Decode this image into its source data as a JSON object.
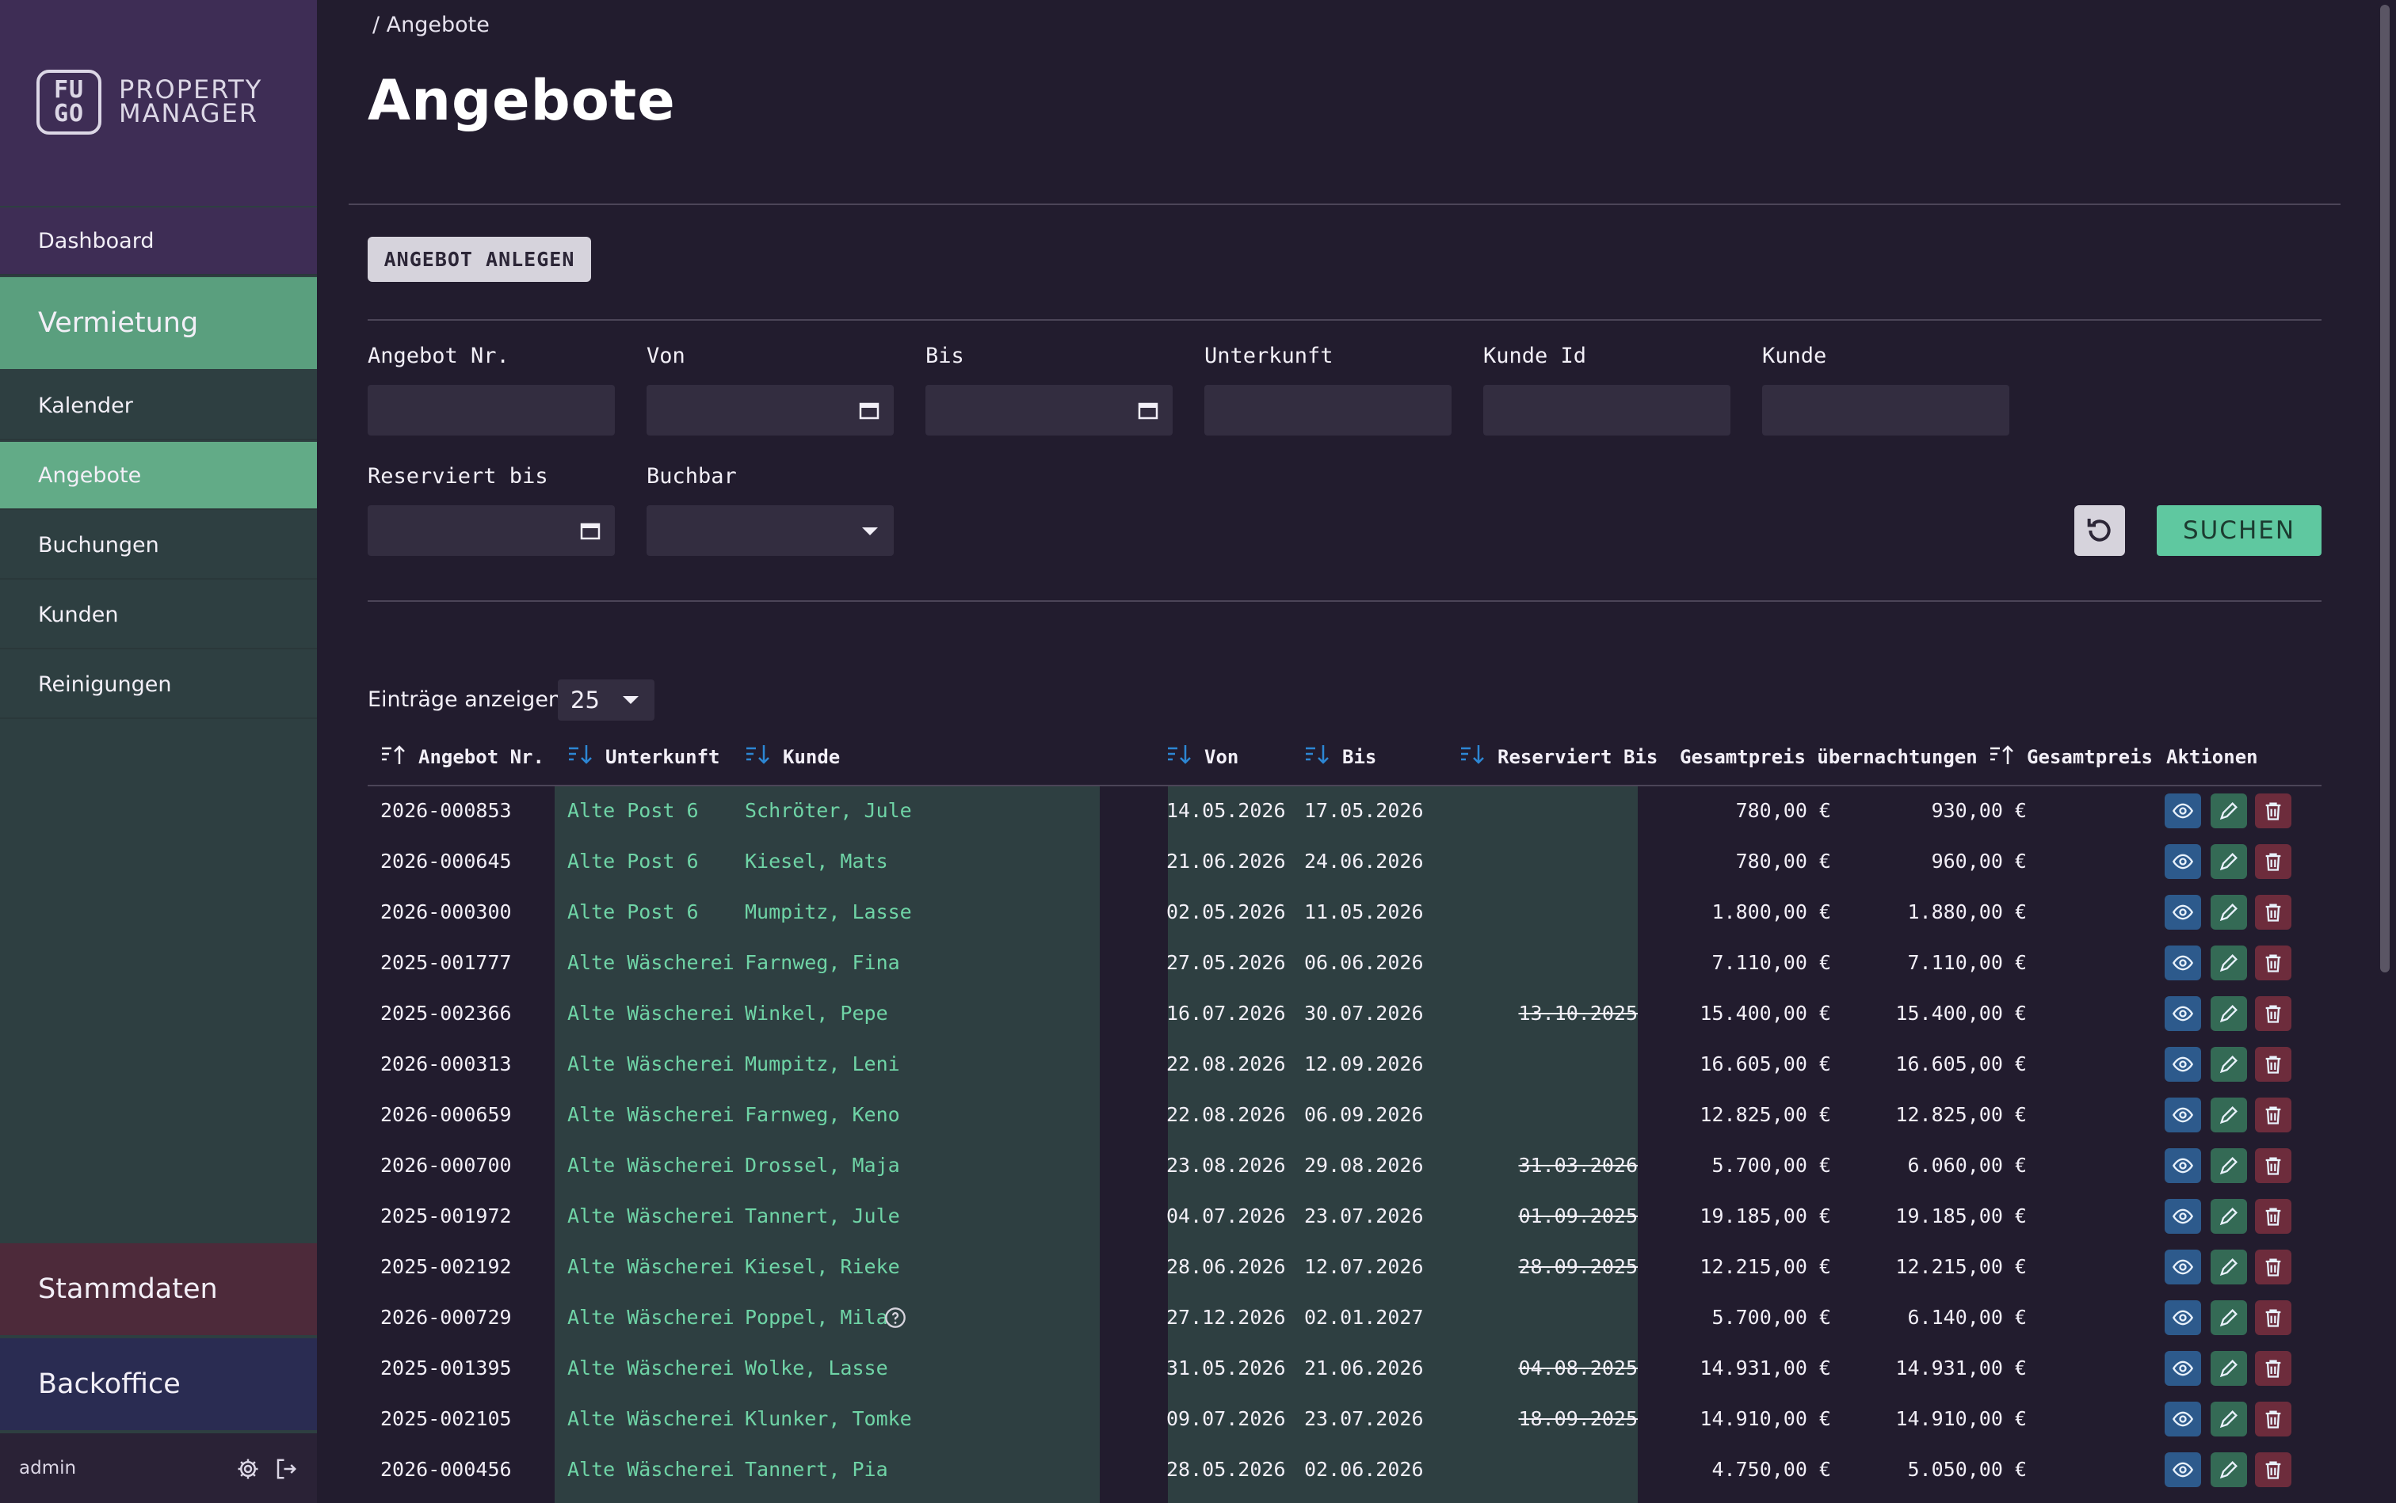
{
  "logo": {
    "mark_top": "FU",
    "mark_bottom": "GO",
    "line1": "PROPERTY",
    "line2": "MANAGER"
  },
  "sidebar": {
    "dashboard": "Dashboard",
    "vermietung": "Vermietung",
    "items": [
      {
        "label": "Kalender"
      },
      {
        "label": "Angebote",
        "active": true
      },
      {
        "label": "Buchungen"
      },
      {
        "label": "Kunden"
      },
      {
        "label": "Reinigungen"
      }
    ],
    "stammdaten": "Stammdaten",
    "backoffice": "Backoffice",
    "user": "admin",
    "settings_icon": "gear-icon",
    "logout_icon": "logout-icon"
  },
  "breadcrumb": "/ Angebote",
  "page_title": "Angebote",
  "create_button": "ANGEBOT ANLEGEN",
  "filters": {
    "angebot_nr": "Angebot Nr.",
    "von": "Von",
    "bis": "Bis",
    "unterkunft": "Unterkunft",
    "kunde_id": "Kunde Id",
    "kunde": "Kunde",
    "reserviert_bis": "Reserviert bis",
    "buchbar": "Buchbar",
    "search_button": "SUCHEN",
    "reset_icon": "reset-icon"
  },
  "entries": {
    "label": "Einträge anzeigen",
    "value": "25"
  },
  "table": {
    "headers": {
      "nr": "Angebot Nr.",
      "unterkunft": "Unterkunft",
      "kunde": "Kunde",
      "von": "Von",
      "bis": "Bis",
      "reserviert": "Reserviert Bis",
      "gp_uebernachtungen": "Gesamtpreis übernachtungen",
      "gesamtpreis": "Gesamtpreis",
      "aktionen": "Aktionen"
    },
    "rows": [
      {
        "nr": "2026-000853",
        "unterkunft": "Alte Post 6",
        "kunde": "Schröter, Jule",
        "von": "14.05.2026",
        "bis": "17.05.2026",
        "reserviert": "",
        "gp_uebernachtungen": "780,00 €",
        "gesamtpreis": "930,00 €"
      },
      {
        "nr": "2026-000645",
        "unterkunft": "Alte Post 6",
        "kunde": "Kiesel, Mats",
        "von": "21.06.2026",
        "bis": "24.06.2026",
        "reserviert": "",
        "gp_uebernachtungen": "780,00 €",
        "gesamtpreis": "960,00 €"
      },
      {
        "nr": "2026-000300",
        "unterkunft": "Alte Post 6",
        "kunde": "Mumpitz, Lasse",
        "von": "02.05.2026",
        "bis": "11.05.2026",
        "reserviert": "",
        "gp_uebernachtungen": "1.800,00 €",
        "gesamtpreis": "1.880,00 €"
      },
      {
        "nr": "2025-001777",
        "unterkunft": "Alte Wäscherei",
        "kunde": "Farnweg, Fina",
        "von": "27.05.2026",
        "bis": "06.06.2026",
        "reserviert": "",
        "gp_uebernachtungen": "7.110,00 €",
        "gesamtpreis": "7.110,00 €"
      },
      {
        "nr": "2025-002366",
        "unterkunft": "Alte Wäscherei",
        "kunde": "Winkel, Pepe",
        "von": "16.07.2026",
        "bis": "30.07.2026",
        "reserviert": "13.10.2025",
        "gp_uebernachtungen": "15.400,00 €",
        "gesamtpreis": "15.400,00 €"
      },
      {
        "nr": "2026-000313",
        "unterkunft": "Alte Wäscherei",
        "kunde": "Mumpitz, Leni",
        "von": "22.08.2026",
        "bis": "12.09.2026",
        "reserviert": "",
        "gp_uebernachtungen": "16.605,00 €",
        "gesamtpreis": "16.605,00 €"
      },
      {
        "nr": "2026-000659",
        "unterkunft": "Alte Wäscherei",
        "kunde": "Farnweg, Keno",
        "von": "22.08.2026",
        "bis": "06.09.2026",
        "reserviert": "",
        "gp_uebernachtungen": "12.825,00 €",
        "gesamtpreis": "12.825,00 €"
      },
      {
        "nr": "2026-000700",
        "unterkunft": "Alte Wäscherei",
        "kunde": "Drossel, Maja",
        "von": "23.08.2026",
        "bis": "29.08.2026",
        "reserviert": "31.03.2026",
        "gp_uebernachtungen": "5.700,00 €",
        "gesamtpreis": "6.060,00 €"
      },
      {
        "nr": "2025-001972",
        "unterkunft": "Alte Wäscherei",
        "kunde": "Tannert, Jule",
        "von": "04.07.2026",
        "bis": "23.07.2026",
        "reserviert": "01.09.2025",
        "gp_uebernachtungen": "19.185,00 €",
        "gesamtpreis": "19.185,00 €"
      },
      {
        "nr": "2025-002192",
        "unterkunft": "Alte Wäscherei",
        "kunde": "Kiesel, Rieke",
        "von": "28.06.2026",
        "bis": "12.07.2026",
        "reserviert": "28.09.2025",
        "gp_uebernachtungen": "12.215,00 €",
        "gesamtpreis": "12.215,00 €"
      },
      {
        "nr": "2026-000729",
        "unterkunft": "Alte Wäscherei",
        "kunde": "Poppel, Mila",
        "von": "27.12.2026",
        "bis": "02.01.2027",
        "reserviert": "",
        "gp_uebernachtungen": "5.700,00 €",
        "gesamtpreis": "6.140,00 €",
        "info": true
      },
      {
        "nr": "2025-001395",
        "unterkunft": "Alte Wäscherei",
        "kunde": "Wolke, Lasse",
        "von": "31.05.2026",
        "bis": "21.06.2026",
        "reserviert": "04.08.2025",
        "gp_uebernachtungen": "14.931,00 €",
        "gesamtpreis": "14.931,00 €"
      },
      {
        "nr": "2025-002105",
        "unterkunft": "Alte Wäscherei",
        "kunde": "Klunker, Tomke",
        "von": "09.07.2026",
        "bis": "23.07.2026",
        "reserviert": "18.09.2025",
        "gp_uebernachtungen": "14.910,00 €",
        "gesamtpreis": "14.910,00 €"
      },
      {
        "nr": "2026-000456",
        "unterkunft": "Alte Wäscherei",
        "kunde": "Tannert, Pia",
        "von": "28.05.2026",
        "bis": "02.06.2026",
        "reserviert": "",
        "gp_uebernachtungen": "4.750,00 €",
        "gesamtpreis": "5.050,00 €"
      }
    ],
    "action_icons": [
      "eye-icon",
      "pencil-icon",
      "trash-icon"
    ]
  }
}
